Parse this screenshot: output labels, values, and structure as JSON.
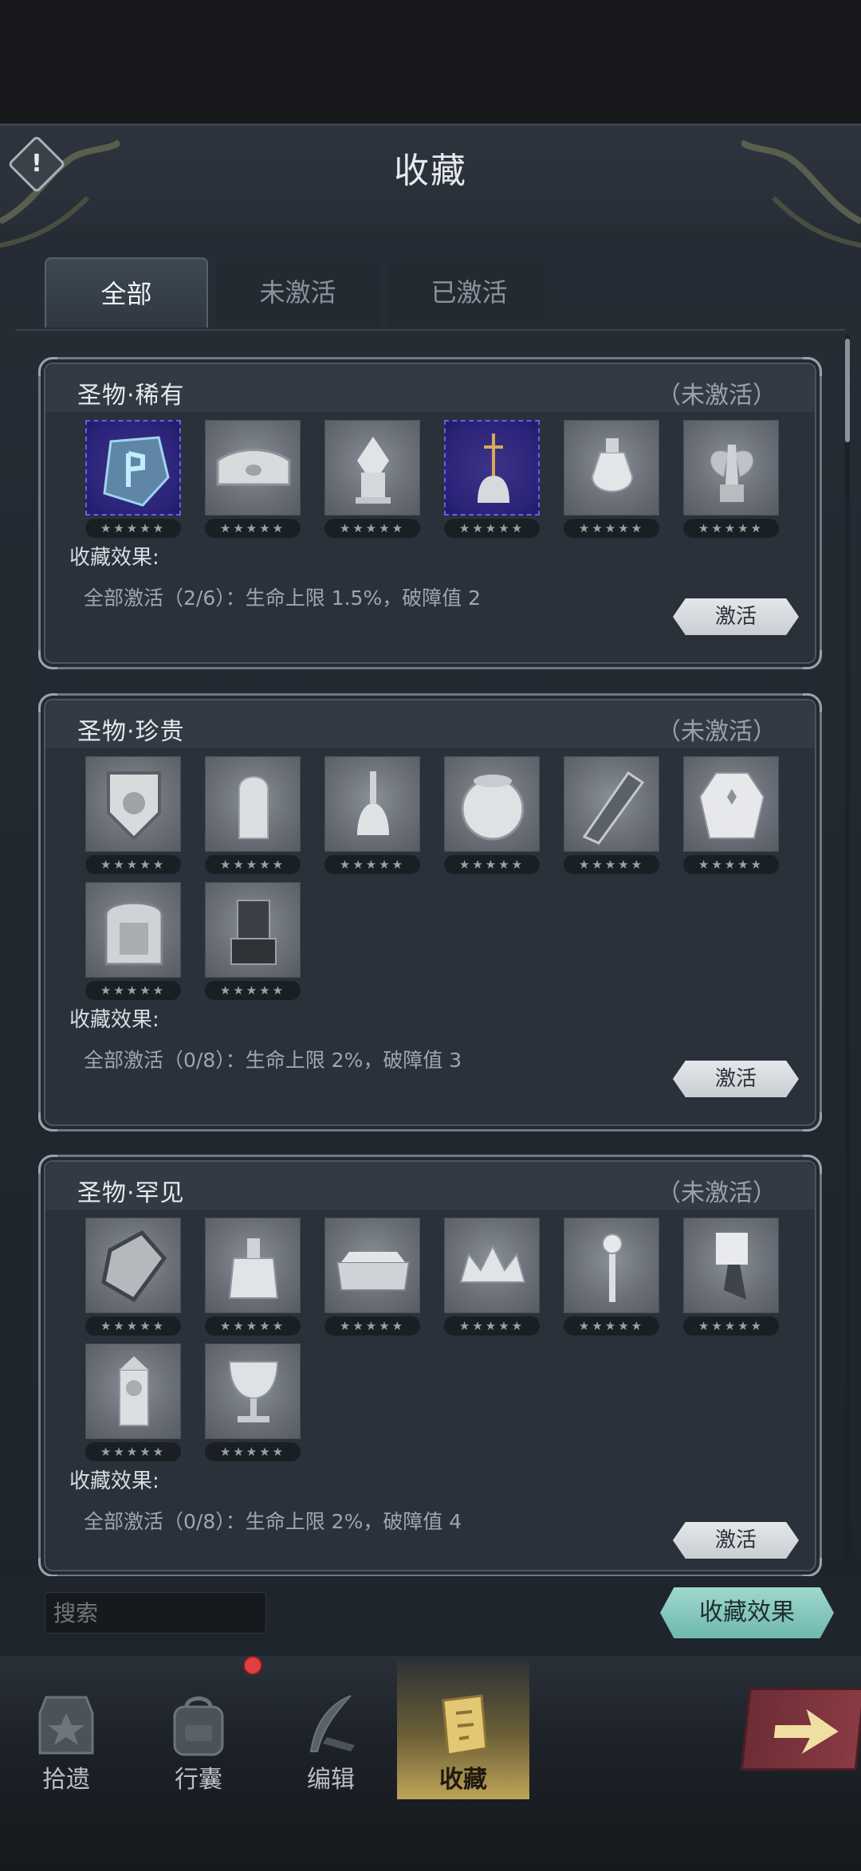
{
  "title": "收藏",
  "tabs": [
    {
      "label": "全部",
      "active": true
    },
    {
      "label": "未激活",
      "active": false
    },
    {
      "label": "已激活",
      "active": false
    }
  ],
  "groups": [
    {
      "name": "圣物·稀有",
      "status": "（未激活）",
      "effect_label": "收藏效果:",
      "effect_text": "全部激活（2/6）：生命上限 1.5%，破障值 2",
      "button": "激活",
      "items": [
        {
          "icon": "rune-stone-icon",
          "rare": true,
          "stars": "★★★★★"
        },
        {
          "icon": "ornate-lid-icon",
          "rare": false,
          "stars": "★★★★★"
        },
        {
          "icon": "winged-pedestal-icon",
          "rare": false,
          "stars": "★★★★★"
        },
        {
          "icon": "cross-bell-icon",
          "rare": true,
          "stars": "★★★★★"
        },
        {
          "icon": "ewer-icon",
          "rare": false,
          "stars": "★★★★★"
        },
        {
          "icon": "angel-statue-icon",
          "rare": false,
          "stars": "★★★★★"
        }
      ]
    },
    {
      "name": "圣物·珍贵",
      "status": "（未激活）",
      "effect_label": "收藏效果:",
      "effect_text": "全部激活（0/8）：生命上限 2%，破障值 3",
      "button": "激活",
      "items": [
        {
          "icon": "shield-emblem-icon",
          "rare": false,
          "stars": "★★★★★"
        },
        {
          "icon": "tombstone-icon",
          "rare": false,
          "stars": "★★★★★"
        },
        {
          "icon": "hand-bell-icon",
          "rare": false,
          "stars": "★★★★★"
        },
        {
          "icon": "round-vase-icon",
          "rare": false,
          "stars": "★★★★★"
        },
        {
          "icon": "stole-icon",
          "rare": false,
          "stars": "★★★★★"
        },
        {
          "icon": "vestment-icon",
          "rare": false,
          "stars": "★★★★★"
        },
        {
          "icon": "altar-icon",
          "rare": false,
          "stars": "★★★★★"
        },
        {
          "icon": "throne-icon",
          "rare": false,
          "stars": "★★★★★"
        }
      ]
    },
    {
      "name": "圣物·罕见",
      "status": "（未激活）",
      "effect_label": "收藏效果:",
      "effect_text": "全部激活（0/8）：生命上限 2%，破障值 4",
      "button": "激活",
      "items": [
        {
          "icon": "gauntlet-icon",
          "rare": false,
          "stars": "★★★★★"
        },
        {
          "icon": "perfume-bottle-icon",
          "rare": false,
          "stars": "★★★★★"
        },
        {
          "icon": "coffin-icon",
          "rare": false,
          "stars": "★★★★★"
        },
        {
          "icon": "crown-icon",
          "rare": false,
          "stars": "★★★★★"
        },
        {
          "icon": "scepter-icon",
          "rare": false,
          "stars": "★★★★★"
        },
        {
          "icon": "banner-icon",
          "rare": false,
          "stars": "★★★★★"
        },
        {
          "icon": "clock-tower-icon",
          "rare": false,
          "stars": "★★★★★"
        },
        {
          "icon": "chalice-icon",
          "rare": false,
          "stars": "★★★★★"
        }
      ]
    }
  ],
  "search": {
    "placeholder": "搜索"
  },
  "effect_button": "收藏效果",
  "nav": [
    {
      "label": "拾遗",
      "icon": "relic-icon",
      "active": false
    },
    {
      "label": "行囊",
      "icon": "backpack-icon",
      "active": false,
      "badge": true
    },
    {
      "label": "编辑",
      "icon": "quill-icon",
      "active": false
    },
    {
      "label": "收藏",
      "icon": "collection-book-icon",
      "active": true
    }
  ],
  "colors": {
    "accent_teal": "#7fc6bb",
    "rare_purple": "#2b247a",
    "nav_gold": "#bfa55a"
  }
}
